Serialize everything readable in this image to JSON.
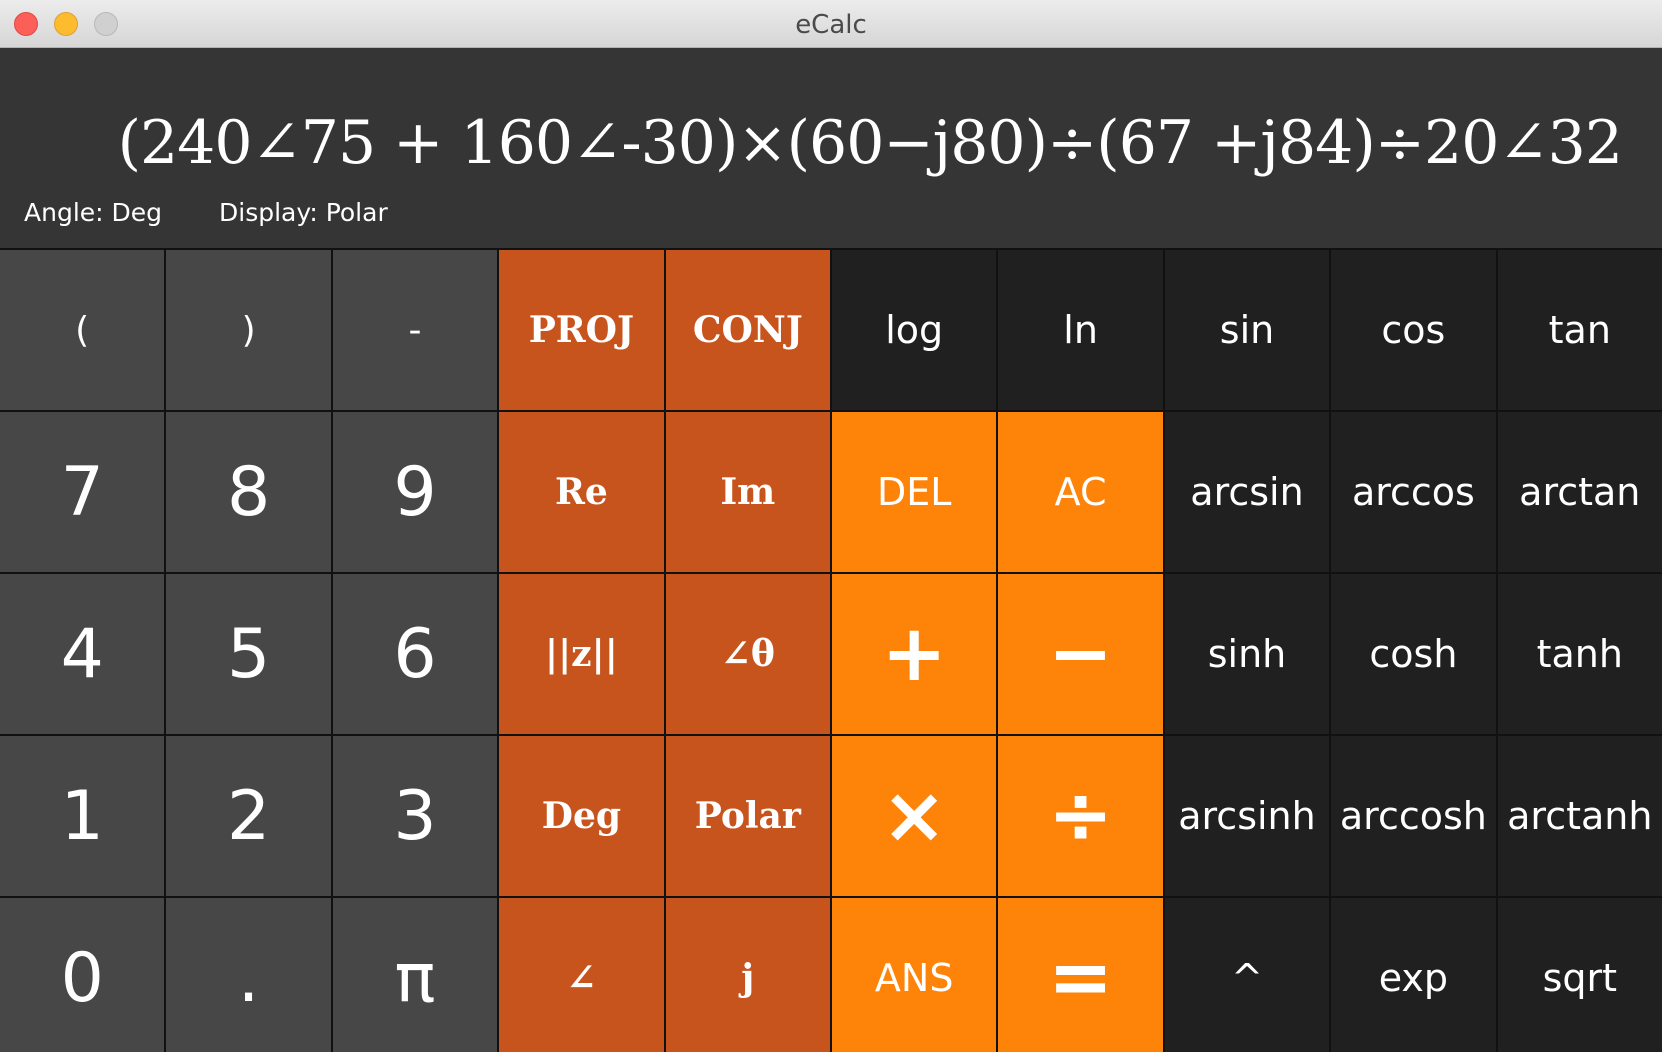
{
  "window": {
    "title": "eCalc"
  },
  "display": {
    "expression": "(240∠75 + 160∠-30)×(60−j80)÷(67 +j84)÷20∠32",
    "angle_status": "Angle: Deg",
    "display_status": "Display: Polar"
  },
  "keys": [
    {
      "label": "(",
      "kind": "num small",
      "name": "open-paren-button"
    },
    {
      "label": ")",
      "kind": "num small",
      "name": "close-paren-button"
    },
    {
      "label": "-",
      "kind": "num small",
      "name": "negate-button"
    },
    {
      "label": "PROJ",
      "kind": "fn",
      "name": "proj-button"
    },
    {
      "label": "CONJ",
      "kind": "fn",
      "name": "conj-button"
    },
    {
      "label": "log",
      "kind": "sci",
      "name": "log-button"
    },
    {
      "label": "ln",
      "kind": "sci",
      "name": "ln-button"
    },
    {
      "label": "sin",
      "kind": "sci",
      "name": "sin-button"
    },
    {
      "label": "cos",
      "kind": "sci",
      "name": "cos-button"
    },
    {
      "label": "tan",
      "kind": "sci",
      "name": "tan-button"
    },
    {
      "label": "7",
      "kind": "num",
      "name": "digit-7-button"
    },
    {
      "label": "8",
      "kind": "num",
      "name": "digit-8-button"
    },
    {
      "label": "9",
      "kind": "num",
      "name": "digit-9-button"
    },
    {
      "label": "Re",
      "kind": "fn",
      "name": "real-part-button"
    },
    {
      "label": "Im",
      "kind": "fn",
      "name": "imag-part-button"
    },
    {
      "label": "DEL",
      "kind": "op",
      "name": "delete-button"
    },
    {
      "label": "AC",
      "kind": "op",
      "name": "all-clear-button"
    },
    {
      "label": "arcsin",
      "kind": "sci",
      "name": "arcsin-button"
    },
    {
      "label": "arccos",
      "kind": "sci",
      "name": "arccos-button"
    },
    {
      "label": "arctan",
      "kind": "sci",
      "name": "arctan-button"
    },
    {
      "label": "4",
      "kind": "num",
      "name": "digit-4-button"
    },
    {
      "label": "5",
      "kind": "num",
      "name": "digit-5-button"
    },
    {
      "label": "6",
      "kind": "num",
      "name": "digit-6-button"
    },
    {
      "label": "||z||",
      "kind": "fn",
      "name": "modulus-button"
    },
    {
      "label": "∠θ",
      "kind": "fn",
      "name": "argument-button"
    },
    {
      "label": "+",
      "kind": "op big",
      "name": "add-button"
    },
    {
      "label": "−",
      "kind": "op big",
      "name": "subtract-button"
    },
    {
      "label": "sinh",
      "kind": "sci",
      "name": "sinh-button"
    },
    {
      "label": "cosh",
      "kind": "sci",
      "name": "cosh-button"
    },
    {
      "label": "tanh",
      "kind": "sci",
      "name": "tanh-button"
    },
    {
      "label": "1",
      "kind": "num",
      "name": "digit-1-button"
    },
    {
      "label": "2",
      "kind": "num",
      "name": "digit-2-button"
    },
    {
      "label": "3",
      "kind": "num",
      "name": "digit-3-button"
    },
    {
      "label": "Deg",
      "kind": "fn",
      "name": "angle-mode-button"
    },
    {
      "label": "Polar",
      "kind": "fn",
      "name": "display-mode-button"
    },
    {
      "label": "×",
      "kind": "op big",
      "name": "multiply-button"
    },
    {
      "label": "÷",
      "kind": "op big",
      "name": "divide-button"
    },
    {
      "label": "arcsinh",
      "kind": "sci",
      "name": "arcsinh-button"
    },
    {
      "label": "arccosh",
      "kind": "sci",
      "name": "arccosh-button"
    },
    {
      "label": "arctanh",
      "kind": "sci",
      "name": "arctanh-button"
    },
    {
      "label": "0",
      "kind": "num",
      "name": "digit-0-button"
    },
    {
      "label": ".",
      "kind": "num",
      "name": "decimal-point-button"
    },
    {
      "label": "π",
      "kind": "num",
      "name": "pi-button"
    },
    {
      "label": "∠",
      "kind": "fn",
      "name": "angle-symbol-button"
    },
    {
      "label": "j",
      "kind": "fn",
      "name": "imaginary-unit-button"
    },
    {
      "label": "ANS",
      "kind": "op",
      "name": "answer-button"
    },
    {
      "label": "=",
      "kind": "op big",
      "name": "equals-button"
    },
    {
      "label": "^",
      "kind": "sci",
      "name": "power-button"
    },
    {
      "label": "exp",
      "kind": "sci",
      "name": "exp-button"
    },
    {
      "label": "sqrt",
      "kind": "sci",
      "name": "sqrt-button"
    }
  ],
  "colors": {
    "number_key": "#474747",
    "function_key": "#c8541d",
    "operator_key": "#fd8309",
    "scientific_key": "#202020",
    "display_bg": "#353535"
  }
}
